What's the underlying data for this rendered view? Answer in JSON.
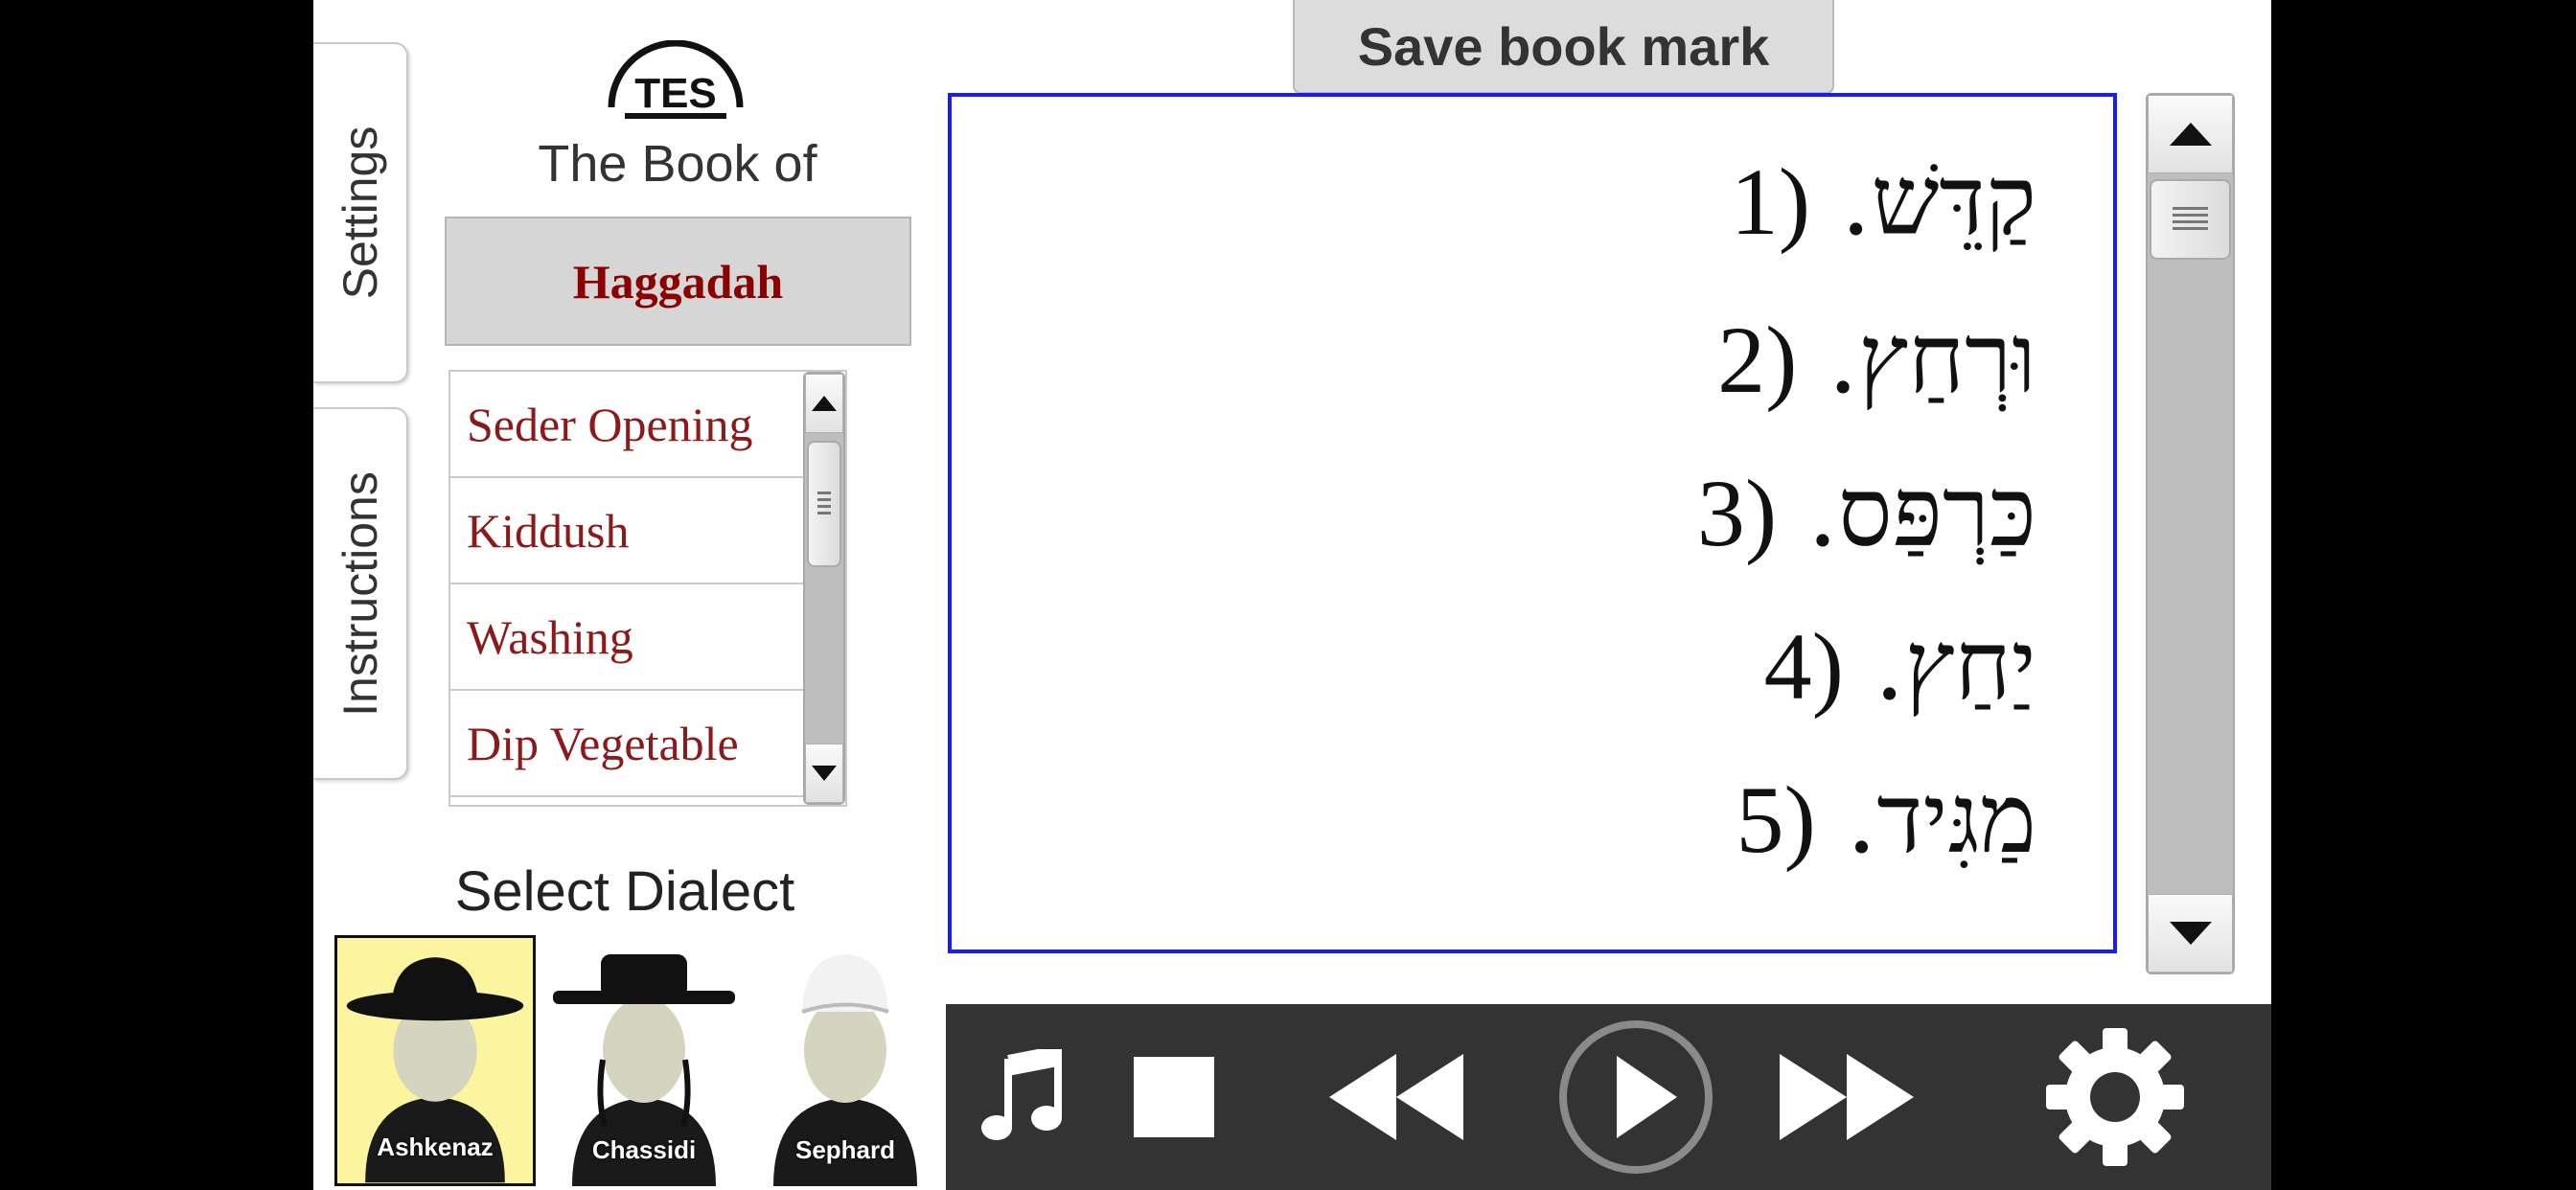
{
  "tabs": {
    "settings": "Settings",
    "instructions": "Instructions"
  },
  "logo": {
    "text": "TES"
  },
  "book": {
    "prefix": "The Book of",
    "title": "Haggadah"
  },
  "chapters": [
    "Seder Opening",
    "Kiddush",
    "Washing",
    "Dip Vegetable"
  ],
  "dialect": {
    "label": "Select Dialect",
    "options": [
      {
        "name": "Ashkenaz",
        "selected": true
      },
      {
        "name": "Chassidi",
        "selected": false
      },
      {
        "name": "Sephard",
        "selected": false
      }
    ]
  },
  "toolbar": {
    "save_label": "Save book mark"
  },
  "reader": {
    "lines": [
      {
        "num": "(1",
        "text": "קַדֵּשׁ."
      },
      {
        "num": "(2",
        "text": "וּרְחַץ."
      },
      {
        "num": "(3",
        "text": "כַּרְפַּס."
      },
      {
        "num": "(4",
        "text": "יַחַץ."
      },
      {
        "num": "(5",
        "text": "מַגִּיד."
      }
    ]
  },
  "player": {
    "buttons": [
      "music-icon",
      "stop-icon",
      "rewind-icon",
      "play-icon",
      "fast-forward-icon",
      "gear-icon"
    ]
  },
  "colors": {
    "accent_blue": "#1a1aff",
    "title_red": "#8b0000",
    "selected_bg": "#fbf5a0",
    "player_bg": "#333333"
  }
}
